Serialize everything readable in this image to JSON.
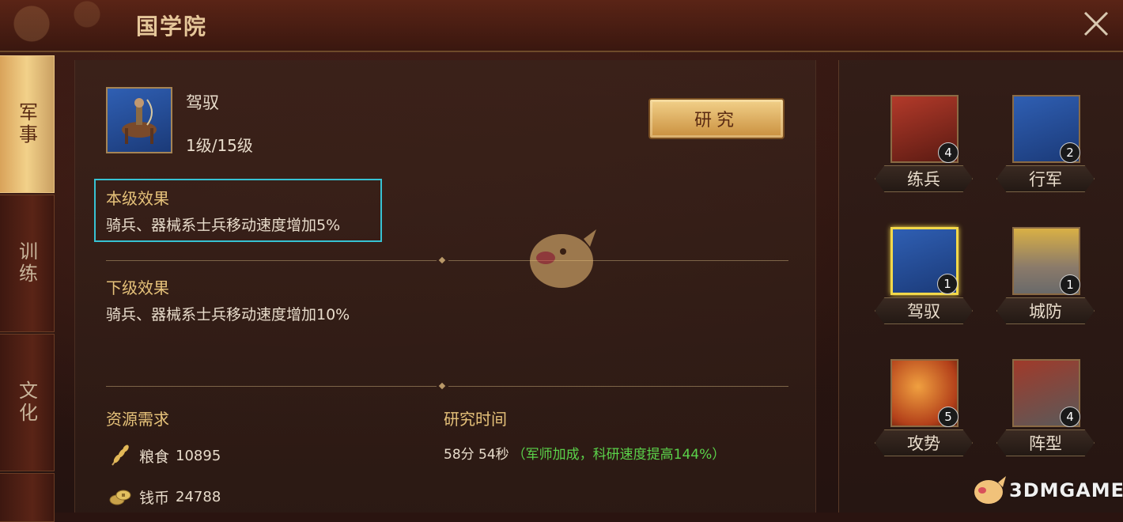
{
  "header": {
    "title": "国学院"
  },
  "tabs": [
    {
      "label": "军事",
      "active": true
    },
    {
      "label": "训练",
      "active": false
    },
    {
      "label": "文化",
      "active": false
    }
  ],
  "skill": {
    "icon": "cavalry-archer-icon",
    "name": "驾驭",
    "level": "1级/15级",
    "research_label": "研究"
  },
  "current_effect": {
    "title": "本级效果",
    "desc": "骑兵、器械系士兵移动速度增加5%"
  },
  "next_effect": {
    "title": "下级效果",
    "desc": "骑兵、器械系士兵移动速度增加10%"
  },
  "resources": {
    "title": "资源需求",
    "items": [
      {
        "icon": "grain-icon",
        "label": "粮食",
        "value": "10895"
      },
      {
        "icon": "coins-icon",
        "label": "钱币",
        "value": "24788"
      }
    ]
  },
  "research_time": {
    "title": "研究时间",
    "value": "58分 54秒",
    "bonus": "（军师加成，科研速度提高144%）"
  },
  "tech_tree": [
    {
      "name": "练兵",
      "level": "4",
      "icon": "soldier-training-icon",
      "selected": false
    },
    {
      "name": "行军",
      "level": "2",
      "icon": "marching-soldiers-icon",
      "selected": false
    },
    {
      "name": "驾驭",
      "level": "1",
      "icon": "cavalry-archer-icon",
      "selected": true
    },
    {
      "name": "城防",
      "level": "1",
      "icon": "city-wall-icon",
      "selected": false
    },
    {
      "name": "攻势",
      "level": "5",
      "icon": "fist-sword-icon",
      "selected": false
    },
    {
      "name": "阵型",
      "level": "4",
      "icon": "formation-icon",
      "selected": false
    }
  ],
  "watermark": {
    "text": "3DMGAME"
  },
  "colors": {
    "accent_gold": "#e6c27a",
    "highlight_cyan": "#37c2d3",
    "bonus_green": "#5bd24a",
    "selected_border": "#f2d84a"
  }
}
